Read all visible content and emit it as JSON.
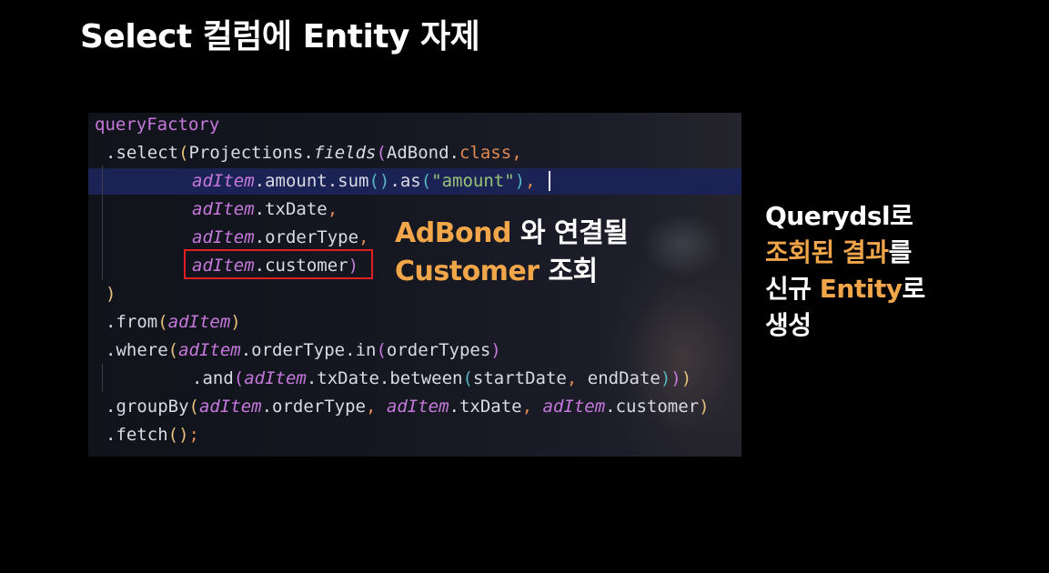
{
  "slide": {
    "title": "Select 컬럼에 Entity 자제"
  },
  "code": {
    "lines": [
      {
        "id": "l1",
        "tokens": [
          {
            "t": "queryFactory",
            "c": "c-field"
          }
        ]
      },
      {
        "id": "l2",
        "tokens": [
          {
            "t": ".select",
            "c": "c-call"
          },
          {
            "t": "(",
            "c": "c-paren"
          },
          {
            "t": "Projections.",
            "c": "c-call"
          },
          {
            "t": "fields",
            "c": "c-italic-white"
          },
          {
            "t": "(",
            "c": "c-paren2"
          },
          {
            "t": "AdBond.",
            "c": "c-call"
          },
          {
            "t": "class",
            "c": "c-kw"
          },
          {
            "t": ",",
            "c": "c-punct"
          }
        ]
      },
      {
        "id": "l3",
        "tokens": [
          {
            "t": "adItem",
            "c": "c-italic"
          },
          {
            "t": ".amount.sum",
            "c": "c-call"
          },
          {
            "t": "()",
            "c": "c-paren3"
          },
          {
            "t": ".as",
            "c": "c-call"
          },
          {
            "t": "(",
            "c": "c-paren3"
          },
          {
            "t": "\"amount\"",
            "c": "c-str"
          },
          {
            "t": ")",
            "c": "c-paren3"
          },
          {
            "t": ",",
            "c": "c-punct"
          }
        ]
      },
      {
        "id": "l4",
        "tokens": [
          {
            "t": "adItem",
            "c": "c-italic"
          },
          {
            "t": ".txDate",
            "c": "c-call"
          },
          {
            "t": ",",
            "c": "c-punct"
          }
        ]
      },
      {
        "id": "l5",
        "tokens": [
          {
            "t": "adItem",
            "c": "c-italic"
          },
          {
            "t": ".orderType",
            "c": "c-call"
          },
          {
            "t": ",",
            "c": "c-punct"
          }
        ]
      },
      {
        "id": "l6",
        "tokens": [
          {
            "t": "adItem",
            "c": "c-italic"
          },
          {
            "t": ".customer",
            "c": "c-call"
          },
          {
            "t": ")",
            "c": "c-paren2"
          }
        ]
      },
      {
        "id": "l7",
        "tokens": [
          {
            "t": ")",
            "c": "c-paren"
          }
        ]
      },
      {
        "id": "l8",
        "tokens": [
          {
            "t": ".from",
            "c": "c-call"
          },
          {
            "t": "(",
            "c": "c-paren"
          },
          {
            "t": "adItem",
            "c": "c-italic"
          },
          {
            "t": ")",
            "c": "c-paren"
          }
        ]
      },
      {
        "id": "l9",
        "tokens": [
          {
            "t": ".where",
            "c": "c-call"
          },
          {
            "t": "(",
            "c": "c-paren"
          },
          {
            "t": "adItem",
            "c": "c-italic"
          },
          {
            "t": ".orderType.in",
            "c": "c-call"
          },
          {
            "t": "(",
            "c": "c-paren2"
          },
          {
            "t": "orderTypes",
            "c": "c-call"
          },
          {
            "t": ")",
            "c": "c-paren2"
          }
        ]
      },
      {
        "id": "l10",
        "tokens": [
          {
            "t": ".and",
            "c": "c-call"
          },
          {
            "t": "(",
            "c": "c-paren2"
          },
          {
            "t": "adItem",
            "c": "c-italic"
          },
          {
            "t": ".txDate.between",
            "c": "c-call"
          },
          {
            "t": "(",
            "c": "c-paren3"
          },
          {
            "t": "startDate",
            "c": "c-call"
          },
          {
            "t": ", ",
            "c": "c-punct"
          },
          {
            "t": "endDate",
            "c": "c-call"
          },
          {
            "t": ")",
            "c": "c-paren3"
          },
          {
            "t": ")",
            "c": "c-paren2"
          },
          {
            "t": ")",
            "c": "c-paren"
          }
        ]
      },
      {
        "id": "l11",
        "tokens": [
          {
            "t": ".groupBy",
            "c": "c-call"
          },
          {
            "t": "(",
            "c": "c-paren"
          },
          {
            "t": "adItem",
            "c": "c-italic"
          },
          {
            "t": ".orderType",
            "c": "c-call"
          },
          {
            "t": ", ",
            "c": "c-punct"
          },
          {
            "t": "adItem",
            "c": "c-italic"
          },
          {
            "t": ".txDate",
            "c": "c-call"
          },
          {
            "t": ", ",
            "c": "c-punct"
          },
          {
            "t": "adItem",
            "c": "c-italic"
          },
          {
            "t": ".customer",
            "c": "c-call"
          },
          {
            "t": ")",
            "c": "c-paren"
          }
        ]
      },
      {
        "id": "l12",
        "tokens": [
          {
            "t": ".fetch",
            "c": "c-call"
          },
          {
            "t": "()",
            "c": "c-paren"
          },
          {
            "t": ";",
            "c": "c-punct"
          }
        ]
      }
    ]
  },
  "annotation": {
    "line1_orange": "AdBond",
    "line1_white": " 와 연결될",
    "line2_orange": "Customer",
    "line2_white": " 조회"
  },
  "side_note": {
    "line1": "Querydsl로",
    "line2_orange": "조회된 결과",
    "line2_white": "를",
    "line3_white_a": "신규 ",
    "line3_orange": "Entity",
    "line3_white_b": "로",
    "line4": "생성"
  },
  "colors": {
    "background": "#000000",
    "accent_orange": "#f2a64a",
    "highlight_box": "#e02020",
    "current_line": "#1b2354"
  }
}
